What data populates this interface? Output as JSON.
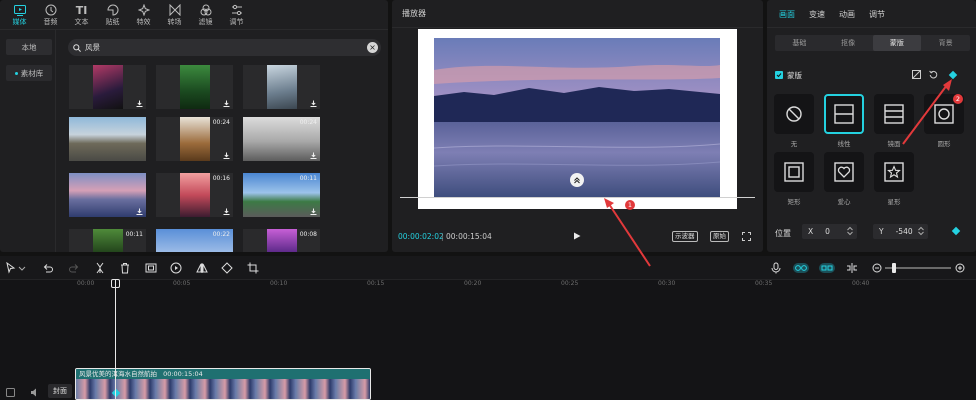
{
  "media": {
    "tabs": [
      {
        "label": "媒体",
        "icon": "media-icon",
        "active": true
      },
      {
        "label": "音频",
        "icon": "audio-icon"
      },
      {
        "label": "文本",
        "icon": "text-icon"
      },
      {
        "label": "贴纸",
        "icon": "sticker-icon"
      },
      {
        "label": "特效",
        "icon": "effects-icon"
      },
      {
        "label": "转场",
        "icon": "transition-icon"
      },
      {
        "label": "滤镜",
        "icon": "filter-icon"
      },
      {
        "label": "调节",
        "icon": "adjust-icon"
      }
    ],
    "side": {
      "local": "本地",
      "library": "素材库"
    },
    "search": {
      "value": "风景"
    },
    "thumbs": [
      {
        "duration": ""
      },
      {
        "duration": ""
      },
      {
        "duration": ""
      },
      {
        "duration": ""
      },
      {
        "duration": "00:24"
      },
      {
        "duration": "00:24"
      },
      {
        "duration": ""
      },
      {
        "duration": "00:16"
      },
      {
        "duration": "00:11"
      },
      {
        "duration": "00:11"
      },
      {
        "duration": "00:22"
      },
      {
        "duration": "00:08"
      }
    ]
  },
  "player": {
    "title": "播放器",
    "current_time": "00:00:02:02",
    "separator": "|",
    "total_time": "00:00:15:04",
    "btn_waveform": "示波器",
    "btn_original": "原始"
  },
  "props": {
    "tabs": [
      {
        "label": "画面",
        "active": true
      },
      {
        "label": "变速"
      },
      {
        "label": "动画"
      },
      {
        "label": "调节"
      }
    ],
    "sub_tabs": [
      {
        "label": "基础"
      },
      {
        "label": "抠像"
      },
      {
        "label": "蒙版",
        "active": true
      },
      {
        "label": "背景"
      }
    ],
    "mask_label": "蒙版",
    "shapes": [
      {
        "label": "无",
        "icon": "no-mask-icon"
      },
      {
        "label": "线性",
        "icon": "linear-mask-icon",
        "selected": true
      },
      {
        "label": "镜面",
        "icon": "mirror-mask-icon"
      },
      {
        "label": "圆形",
        "icon": "circle-mask-icon"
      },
      {
        "label": "矩形",
        "icon": "rectangle-mask-icon"
      },
      {
        "label": "爱心",
        "icon": "heart-mask-icon"
      },
      {
        "label": "星形",
        "icon": "star-mask-icon"
      }
    ],
    "position_label": "位置",
    "pos_x_key": "X",
    "pos_x": "0",
    "pos_y_key": "Y",
    "pos_y": "-540"
  },
  "timeline": {
    "ticks": [
      "00:00",
      "00:05",
      "00:10",
      "00:15",
      "00:20",
      "00:25",
      "00:30",
      "00:35",
      "00:40"
    ],
    "clip_title": "风景优美的洱海水自然航拍",
    "clip_duration": "00:00:15:04",
    "cover_label": "封面"
  },
  "annotations": {
    "one": "1",
    "two": "2"
  },
  "colors": {
    "accent": "#24d1e0",
    "annotation": "#e2393b"
  }
}
